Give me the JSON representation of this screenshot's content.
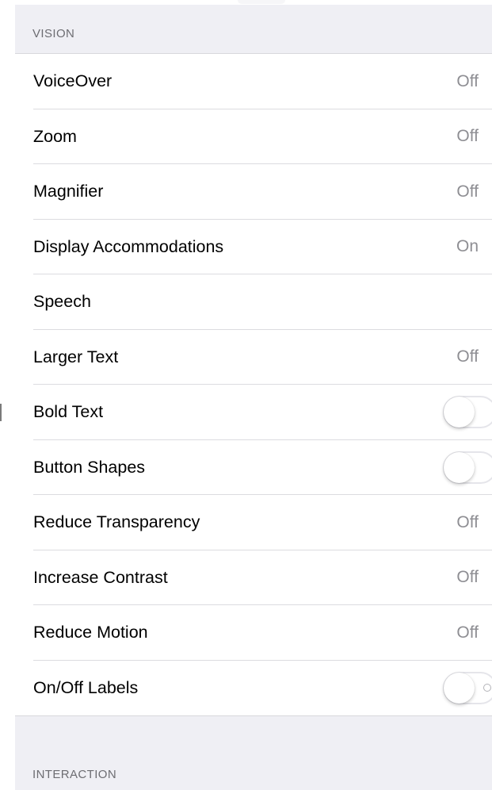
{
  "vision_section": {
    "header": "VISION",
    "rows": [
      {
        "label": "VoiceOver",
        "value": "Off"
      },
      {
        "label": "Zoom",
        "value": "Off"
      },
      {
        "label": "Magnifier",
        "value": "Off"
      },
      {
        "label": "Display Accommodations",
        "value": "On"
      },
      {
        "label": "Speech",
        "value": ""
      },
      {
        "label": "Larger Text",
        "value": "Off"
      },
      {
        "label": "Bold Text",
        "toggle": false
      },
      {
        "label": "Button Shapes",
        "toggle": false
      },
      {
        "label": "Reduce Transparency",
        "value": "Off"
      },
      {
        "label": "Increase Contrast",
        "value": "Off"
      },
      {
        "label": "Reduce Motion",
        "value": "Off"
      },
      {
        "label": "On/Off Labels",
        "toggle": false
      }
    ]
  },
  "interaction_section": {
    "header": "INTERACTION"
  },
  "colors": {
    "group_background": "#efeff4",
    "cell_background": "#ffffff",
    "label_text": "#000000",
    "secondary_text": "#8e8e93",
    "section_header_text": "#6d6d72",
    "separator": "#dcdce0",
    "toggle_off_border": "#e5e5ea"
  },
  "icons": {
    "toggle_off_label": "circle-o-icon"
  }
}
